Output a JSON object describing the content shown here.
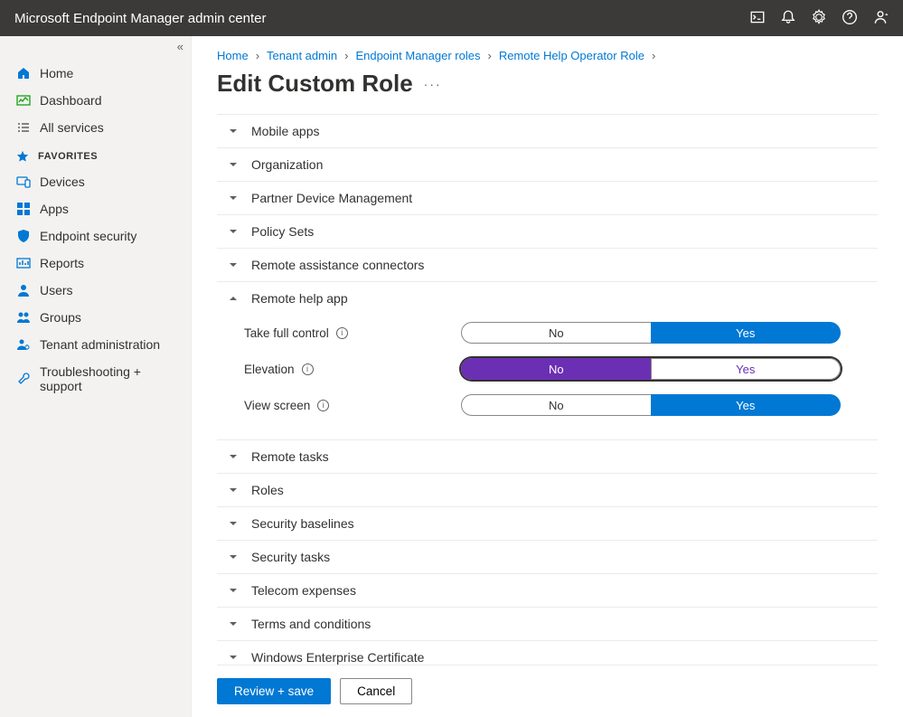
{
  "topbar": {
    "title": "Microsoft Endpoint Manager admin center"
  },
  "sidebar": {
    "home": "Home",
    "dashboard": "Dashboard",
    "allservices": "All services",
    "favorites_header": "FAVORITES",
    "devices": "Devices",
    "apps": "Apps",
    "endpoint_security": "Endpoint security",
    "reports": "Reports",
    "users": "Users",
    "groups": "Groups",
    "tenant_admin": "Tenant administration",
    "troubleshooting": "Troubleshooting + support"
  },
  "breadcrumb": {
    "home": "Home",
    "tenant": "Tenant admin",
    "roles": "Endpoint Manager roles",
    "current": "Remote Help Operator Role"
  },
  "page": {
    "title": "Edit Custom Role"
  },
  "sections": {
    "mobile_apps": "Mobile apps",
    "organization": "Organization",
    "partner": "Partner Device Management",
    "policy_sets": "Policy Sets",
    "remote_connectors": "Remote assistance connectors",
    "remote_help_app": "Remote help app",
    "remote_tasks": "Remote tasks",
    "roles": "Roles",
    "security_baselines": "Security baselines",
    "security_tasks": "Security tasks",
    "telecom": "Telecom expenses",
    "terms": "Terms and conditions",
    "win_cert": "Windows Enterprise Certificate"
  },
  "permissions": {
    "take_full_control": {
      "label": "Take full control",
      "no": "No",
      "yes": "Yes",
      "value": "Yes"
    },
    "elevation": {
      "label": "Elevation",
      "no": "No",
      "yes": "Yes",
      "value": "No"
    },
    "view_screen": {
      "label": "View screen",
      "no": "No",
      "yes": "Yes",
      "value": "Yes"
    }
  },
  "footer": {
    "review": "Review + save",
    "cancel": "Cancel"
  }
}
